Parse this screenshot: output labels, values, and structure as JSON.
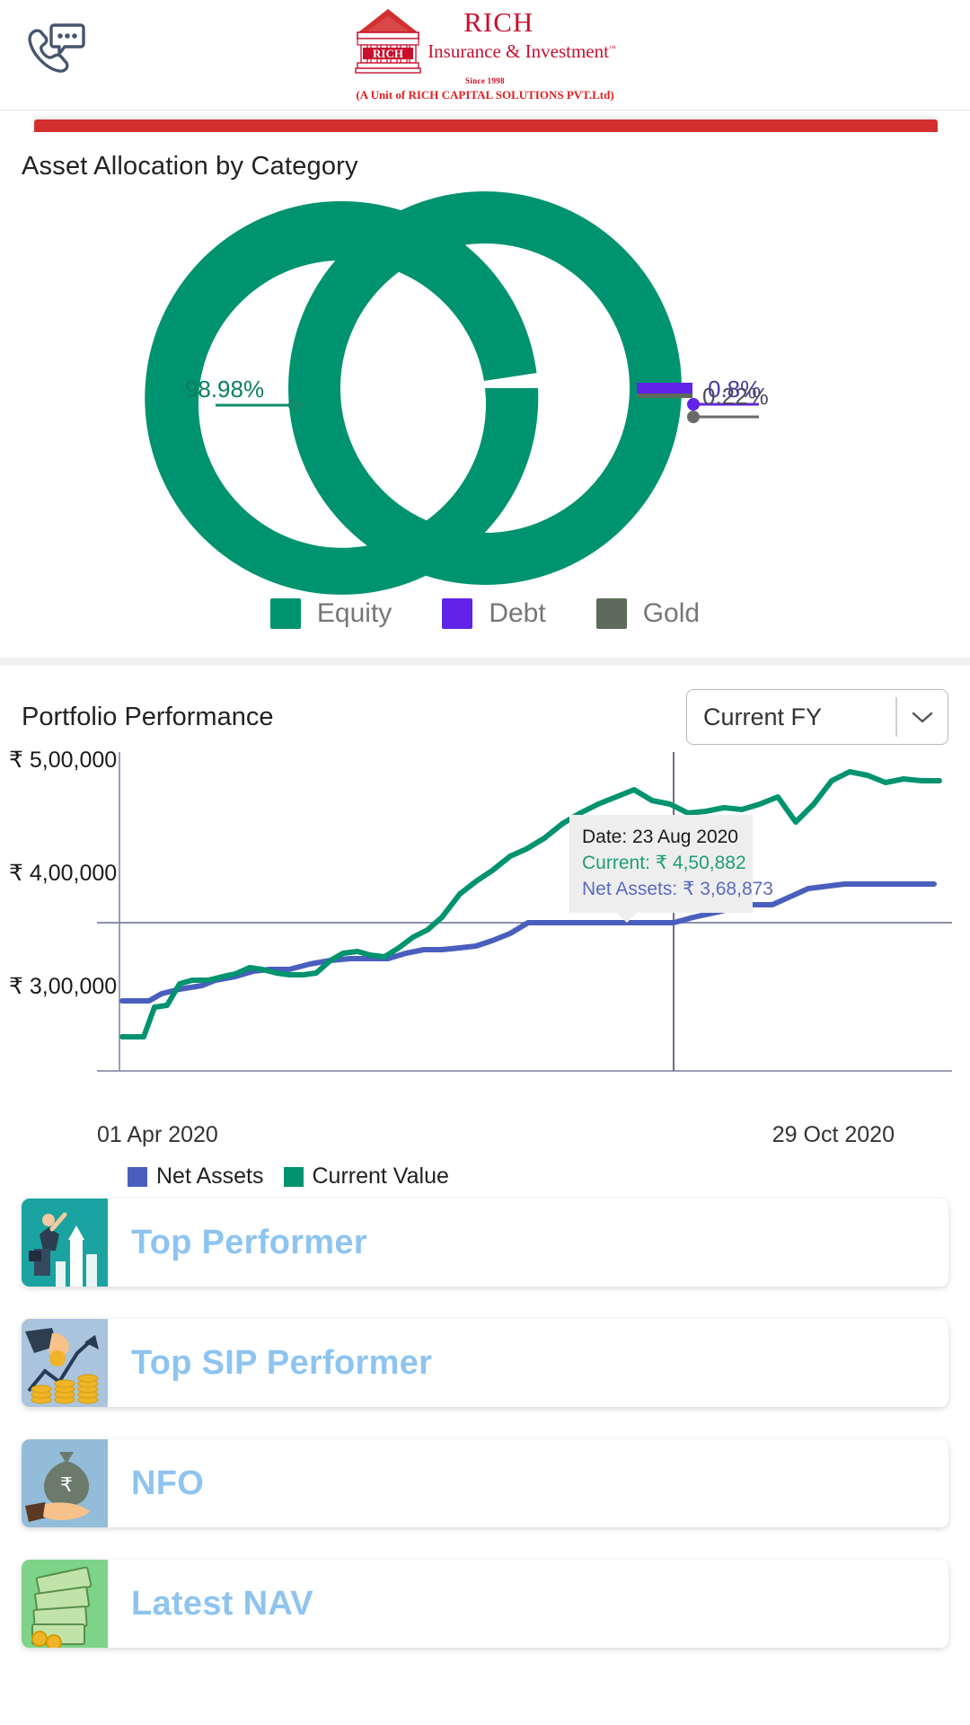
{
  "header": {
    "call_icon": "phone-chat-icon",
    "brand": {
      "name": "RICH",
      "tagline": "Insurance & Investment",
      "tm": "™",
      "since": "Since 1998",
      "unit": "(A Unit of RICH CAPITAL SOLUTIONS PVT.Ltd)",
      "logo_text": "RICH",
      "color": "#c8102e"
    }
  },
  "allocation": {
    "title": "Asset Allocation by Category",
    "legend": [
      {
        "label": "Equity",
        "color": "#00936f"
      },
      {
        "label": "Debt",
        "color": "#6123e8"
      },
      {
        "label": "Gold",
        "color": "#5d6b5b"
      }
    ],
    "labels": {
      "equity": "98.98%",
      "debt": "0.8%",
      "gold": "0.22%"
    }
  },
  "performance": {
    "title": "Portfolio Performance",
    "period_select": {
      "value": "Current FY",
      "icon": "chevron-down-icon"
    },
    "tooltip": {
      "date_label": "Date: 23 Aug 2020",
      "current_label": "Current: ₹ 4,50,882",
      "net_assets_label": "Net Assets: ₹ 3,68,873"
    },
    "x_start": "01 Apr 2020",
    "x_end": "29 Oct 2020",
    "series_legend": [
      {
        "label": "Net Assets",
        "color": "#4a5fbd"
      },
      {
        "label": "Current Value",
        "color": "#00936f"
      }
    ]
  },
  "menu": {
    "items": [
      {
        "label": "Top Performer",
        "icon": "businessman-growth-icon",
        "bg": "#1aa3a0"
      },
      {
        "label": "Top SIP Performer",
        "icon": "hand-coins-chart-icon",
        "bg": "#aac4dd"
      },
      {
        "label": "NFO",
        "icon": "money-bag-hand-icon",
        "bg": "#93bcd8"
      },
      {
        "label": "Latest NAV",
        "icon": "cash-stack-icon",
        "bg": "#7dd488"
      }
    ]
  },
  "chart_data": [
    {
      "type": "pie",
      "title": "Asset Allocation by Category",
      "labels": [
        "Equity",
        "Debt",
        "Gold"
      ],
      "values": [
        98.98,
        0.8,
        0.22
      ],
      "value_labels": [
        "98.98%",
        "0.8%",
        "0.22%"
      ],
      "colors": [
        "#00936f",
        "#6123e8",
        "#5d6b5b"
      ],
      "donut": true,
      "legend_position": "bottom"
    },
    {
      "type": "line",
      "title": "Portfolio Performance",
      "xlabel": "",
      "ylabel": "",
      "ylim": [
        250000,
        500000
      ],
      "yticks": [
        300000,
        400000,
        500000
      ],
      "ytick_labels": [
        "₹ 3,00,000",
        "₹ 4,00,000",
        "₹ 5,00,000"
      ],
      "x": [
        "01 Apr 2020",
        "29 Oct 2020"
      ],
      "grid": false,
      "legend_position": "bottom-left",
      "annotation": {
        "date": "23 Aug 2020",
        "current": 450882,
        "net_assets": 368873
      },
      "series": [
        {
          "name": "Net Assets",
          "color": "#4a5fbd",
          "values": [
            286000,
            286000,
            288000,
            293000,
            295000,
            296000,
            298000,
            300000,
            302000,
            302000,
            305000,
            307000,
            310000,
            312000,
            312000,
            315000,
            318000,
            320000,
            320000,
            322000,
            325000,
            330000,
            340000,
            352000,
            352000,
            368873,
            368873,
            372000,
            382000,
            390000,
            390000,
            390000
          ]
        },
        {
          "name": "Current Value",
          "color": "#00936f",
          "values": [
            262000,
            262000,
            285000,
            286000,
            300000,
            303000,
            303000,
            308000,
            312000,
            318000,
            317000,
            313000,
            312000,
            312000,
            313000,
            325000,
            340000,
            345000,
            342000,
            340000,
            352000,
            365000,
            378000,
            395000,
            430000,
            450882,
            462000,
            448000,
            452000,
            455000,
            478000,
            452000,
            468000,
            480000,
            478000,
            472000,
            476000,
            472000,
            474000
          ]
        }
      ]
    }
  ]
}
